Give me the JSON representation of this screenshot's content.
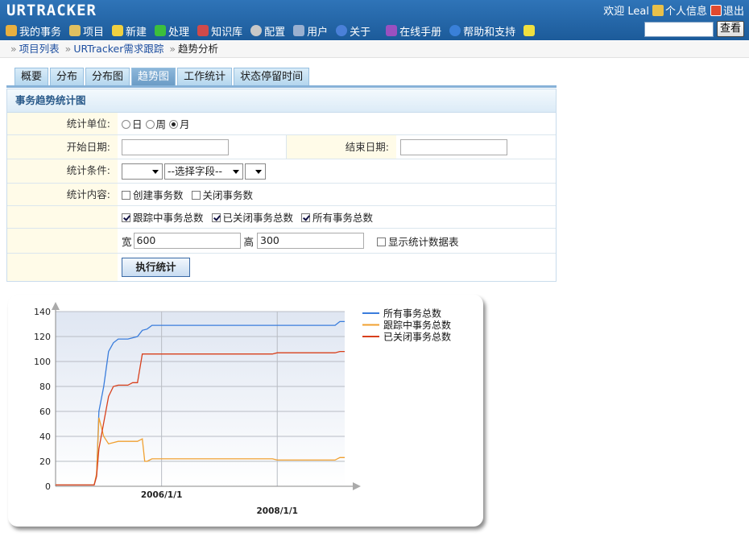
{
  "header": {
    "logo": "URTRACKER",
    "greeting": "欢迎 Leal",
    "profile_label": "个人信息",
    "logout_label": "退出",
    "menu": [
      {
        "label": "我的事务",
        "icon": "home-icon"
      },
      {
        "label": "项目",
        "icon": "database-icon"
      },
      {
        "label": "新建",
        "icon": "new-icon"
      },
      {
        "label": "处理",
        "icon": "check-icon"
      },
      {
        "label": "知识库",
        "icon": "books-icon"
      },
      {
        "label": "配置",
        "icon": "gear-icon"
      },
      {
        "label": "用户",
        "icon": "users-icon"
      },
      {
        "label": "关于",
        "icon": "info-icon"
      },
      {
        "label": "在线手册",
        "icon": "manual-icon"
      },
      {
        "label": "帮助和支持",
        "icon": "help-icon"
      },
      {
        "label": "",
        "icon": "sparkle-icon"
      }
    ],
    "search_value": "",
    "search_button": "查看"
  },
  "breadcrumb": {
    "items": [
      "项目列表",
      "URTracker需求跟踪",
      "趋势分析"
    ],
    "separator": "»"
  },
  "tabs": {
    "items": [
      "概要",
      "分布",
      "分布图",
      "趋势图",
      "工作统计",
      "状态停留时间"
    ],
    "active": 3
  },
  "form": {
    "title": "事务趋势统计图",
    "unit_label": "统计单位:",
    "unit_options": [
      "日",
      "周",
      "月"
    ],
    "unit_selected": "月",
    "start_label": "开始日期:",
    "start_value": "",
    "end_label": "结束日期:",
    "end_value": "",
    "cond_label": "统计条件:",
    "cond_field_placeholder": "--选择字段--",
    "content_label": "统计内容:",
    "checks_row1": [
      {
        "label": "创建事务数",
        "checked": false
      },
      {
        "label": "关闭事务数",
        "checked": false
      }
    ],
    "checks_row2": [
      {
        "label": "跟踪中事务总数",
        "checked": true
      },
      {
        "label": "已关闭事务总数",
        "checked": true
      },
      {
        "label": "所有事务总数",
        "checked": true
      }
    ],
    "width_label": "宽",
    "width_value": "600",
    "height_label": "高",
    "height_value": "300",
    "show_table_label": "显示统计数据表",
    "show_table_checked": false,
    "run_button": "执行统计"
  },
  "chart_data": {
    "type": "line",
    "title": "",
    "xlabel": "",
    "ylabel": "",
    "ylim": [
      0,
      140
    ],
    "y_ticks": [
      0,
      20,
      40,
      60,
      80,
      100,
      120,
      140
    ],
    "x_ticks": [
      {
        "label": "2006/1/1",
        "month_index": 22,
        "row": 0
      },
      {
        "label": "2008/1/1",
        "month_index": 46,
        "row": 1
      }
    ],
    "x_month_range": [
      0,
      60
    ],
    "grid": true,
    "legend_position": "right",
    "series": [
      {
        "name": "所有事务总数",
        "color": "#3a7ddc",
        "points": [
          [
            0,
            1
          ],
          [
            8,
            1
          ],
          [
            8.5,
            8
          ],
          [
            9,
            60
          ],
          [
            10,
            80
          ],
          [
            11,
            108
          ],
          [
            12,
            115
          ],
          [
            13,
            118
          ],
          [
            15,
            118
          ],
          [
            17,
            120
          ],
          [
            18,
            125
          ],
          [
            19,
            126
          ],
          [
            20,
            129
          ],
          [
            45,
            129
          ],
          [
            58,
            129
          ],
          [
            59,
            132
          ],
          [
            60,
            132
          ]
        ]
      },
      {
        "name": "跟踪中事务总数",
        "color": "#f0a030",
        "points": [
          [
            0,
            1
          ],
          [
            8,
            1
          ],
          [
            8.5,
            10
          ],
          [
            9,
            55
          ],
          [
            10,
            40
          ],
          [
            11,
            34
          ],
          [
            12,
            35
          ],
          [
            13,
            36
          ],
          [
            17,
            36
          ],
          [
            18,
            38
          ],
          [
            18.5,
            20
          ],
          [
            19,
            20
          ],
          [
            20,
            22
          ],
          [
            45,
            22
          ],
          [
            46,
            21
          ],
          [
            58,
            21
          ],
          [
            59,
            23
          ],
          [
            60,
            23
          ]
        ]
      },
      {
        "name": "已关闭事务总数",
        "color": "#d8401c",
        "points": [
          [
            0,
            1
          ],
          [
            8,
            1
          ],
          [
            8.5,
            8
          ],
          [
            9,
            30
          ],
          [
            11,
            72
          ],
          [
            12,
            80
          ],
          [
            13,
            81
          ],
          [
            15,
            81
          ],
          [
            16,
            83
          ],
          [
            17,
            83
          ],
          [
            18,
            106
          ],
          [
            45,
            106
          ],
          [
            46,
            107
          ],
          [
            58,
            107
          ],
          [
            59,
            108
          ],
          [
            60,
            108
          ]
        ]
      }
    ]
  }
}
